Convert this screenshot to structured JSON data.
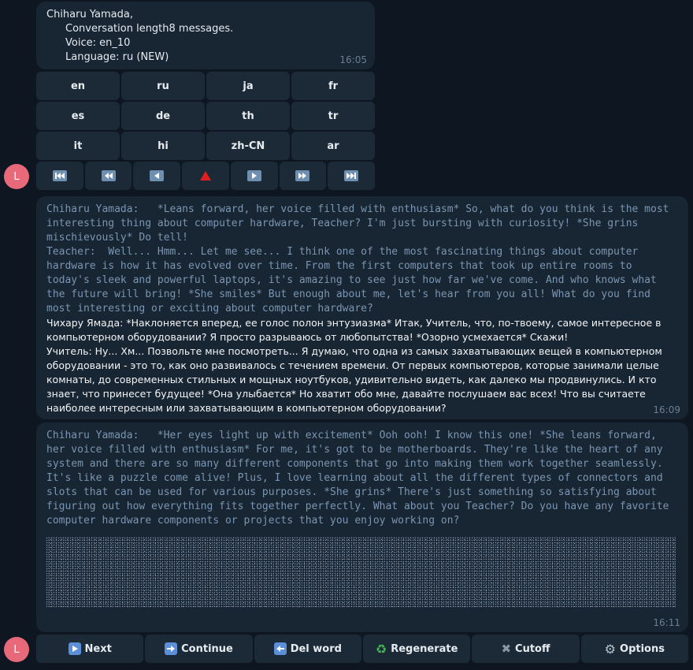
{
  "info_message": {
    "name_line": "Chiharu Yamada,",
    "conv_line": "Conversation length8 messages.",
    "voice_line": "Voice: en_10",
    "language_line": "Language: ru (NEW)",
    "time": "16:05"
  },
  "language_buttons": [
    "en",
    "ru",
    "ja",
    "fr",
    "es",
    "de",
    "th",
    "tr",
    "it",
    "hi",
    "zh-CN",
    "ar"
  ],
  "media_controls": [
    {
      "name": "first-icon"
    },
    {
      "name": "rewind-icon"
    },
    {
      "name": "previous-icon"
    },
    {
      "name": "up-triangle-icon"
    },
    {
      "name": "play-icon"
    },
    {
      "name": "fast-forward-icon"
    },
    {
      "name": "last-icon"
    }
  ],
  "message1": {
    "en_text": "Chiharu Yamada:   *Leans forward, her voice filled with enthusiasm* So, what do you think is the most interesting thing about computer hardware, Teacher? I'm just bursting with curiosity! *She grins mischievously* Do tell!\nTeacher:  Well... Hmm... Let me see... I think one of the most fascinating things about computer hardware is how it has evolved over time. From the first computers that took up entire rooms to today's sleek and powerful laptops, it's amazing to see just how far we've come. And who knows what the future will bring! *She smiles* But enough about me, let's hear from you all! What do you find most interesting or exciting about computer hardware?",
    "ru_text": "Чихару Ямада: *Наклоняется вперед, ее голос полон энтузиазма* Итак, Учитель, что, по-твоему, самое интересное в компьютерном оборудовании? Я просто разрываюсь от любопытства! *Озорно усмехается* Скажи!\nУчитель: Ну... Хм... Позвольте мне посмотреть... Я думаю, что одна из самых захватывающих вещей в компьютерном оборудовании - это то, как оно развивалось с течением времени. От первых компьютеров, которые занимали целые комнаты, до современных стильных и мощных ноутбуков, удивительно видеть, как далеко мы продвинулись. И кто знает, что принесет будущее! *Она улыбается* Но хватит обо мне, давайте послушаем вас всех! Что вы считаете наиболее интересным или захватывающим в компьютерном оборудовании?",
    "time": "16:09"
  },
  "message2": {
    "en_text": "Chiharu Yamada:   *Her eyes light up with excitement* Ooh ooh! I know this one! *She leans forward, her voice filled with enthusiasm* For me, it's got to be motherboards. They're like the heart of any system and there are so many different components that go into making them work together seamlessly. It's like a puzzle come alive! Plus, I love learning about all the different types of connectors and slots that can be used for various purposes. *She grins* There's just something so satisfying about figuring out how everything fits together perfectly. What about you Teacher? Do you have any favorite computer hardware components or projects that you enjoy working on?",
    "time": "16:11"
  },
  "actions": [
    {
      "label": "Next",
      "icon": "next-icon"
    },
    {
      "label": "Continue",
      "icon": "continue-icon"
    },
    {
      "label": "Del word",
      "icon": "delete-word-icon"
    },
    {
      "label": "Regenerate",
      "icon": "recycle-icon"
    },
    {
      "label": "Cutoff",
      "icon": "cross-icon"
    },
    {
      "label": "Options",
      "icon": "gear-icon"
    }
  ],
  "avatar_letter": "L",
  "colors": {
    "background": "#0e1621",
    "bubble": "#182533",
    "button": "#1c2a38",
    "avatar": "#e86a7a",
    "mono_text": "#7b96b2"
  }
}
